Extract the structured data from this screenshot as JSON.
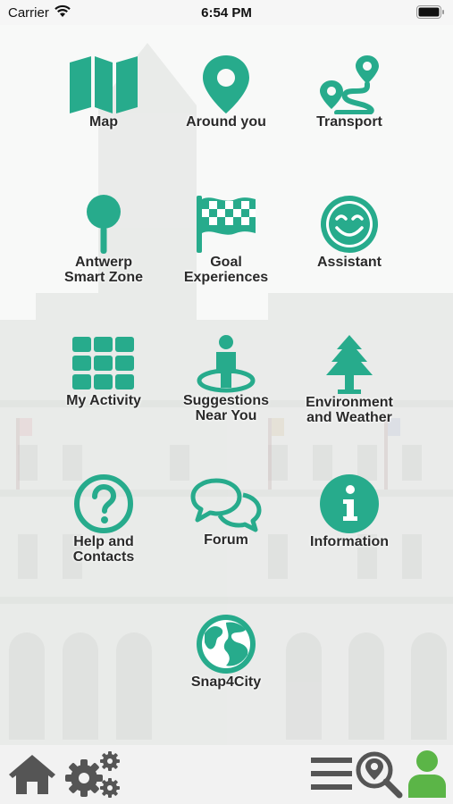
{
  "status_bar": {
    "carrier": "Carrier",
    "time": "6:54 PM"
  },
  "colors": {
    "accent": "#27ab8c",
    "bar_icon": "#555555",
    "user_icon": "#5bb547"
  },
  "menu": [
    {
      "label": "Map",
      "icon": "map-icon"
    },
    {
      "label": "Around you",
      "icon": "location-pin-icon"
    },
    {
      "label": "Transport",
      "icon": "route-icon"
    },
    {
      "label": "Antwerp\nSmart Zone",
      "icon": "pushpin-icon"
    },
    {
      "label": "Goal\nExperiences",
      "icon": "checkered-flag-icon"
    },
    {
      "label": "Assistant",
      "icon": "smiley-icon"
    },
    {
      "label": "My Activity",
      "icon": "grid-icon"
    },
    {
      "label": "Suggestions\nNear You",
      "icon": "person-on-spot-icon"
    },
    {
      "label": "Environment\nand Weather",
      "icon": "tree-icon"
    },
    {
      "label": "Help and\nContacts",
      "icon": "question-icon"
    },
    {
      "label": "Forum",
      "icon": "chat-bubbles-icon"
    },
    {
      "label": "Information",
      "icon": "info-icon"
    },
    {
      "label": "Snap4City",
      "icon": "globe-icon"
    }
  ],
  "bottom_bar": [
    "home-icon",
    "settings-gears-icon",
    "menu-lines-icon",
    "map-search-icon",
    "user-icon"
  ]
}
